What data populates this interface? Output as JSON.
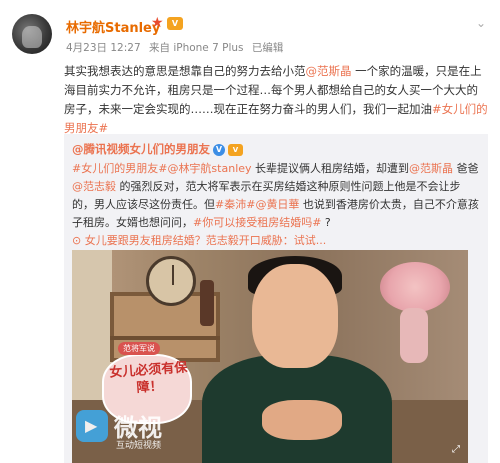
{
  "post": {
    "username": "林宇航Stanley",
    "date": "4月23日 12:27",
    "source": "来自 iPhone 7 Plus",
    "edited": "已编辑",
    "text_intro": "其实我想表达的意思是想靠自己的努力去给小范",
    "mention1": "@范斯晶",
    "text_mid": " 一个家的温暖，只是在上海目前实力不允许，租房只是一个过程…每个男人都想给自己的女人买一个大大的房子，未来一定会实现的……现在正在努力奋斗的男人们，我们一起加油",
    "hashtag": "#女儿们的男朋友#"
  },
  "repost": {
    "username": "@腾讯视频女儿们的男朋友",
    "text_hashtag": "#女儿们的男朋友#",
    "mention_author": "@林宇航stanley",
    "text_a": " 长辈提议俩人租房结婚，却遭到",
    "mention_fan": "@范斯晶",
    "text_b": " 爸爸",
    "mention_zhi": "@范志毅",
    "text_c": " 的强烈反对，范大将军表示在买房结婚这种原则性问题上他是不会让步的，男人应该尽这份责任。但",
    "mention_mao": "#秦沛#",
    "mention_huang": "@黄日華",
    "text_d": " 也说到香港房价太贵，自己不介意孩子租房。女婿也想问问，",
    "hashtag_question": "#你可以接受租房结婚吗#",
    "text_e": " ?",
    "link_label": "女儿要跟男友租房结婚？范志毅开口威胁：试试..."
  },
  "video": {
    "badge": "范将军说",
    "caption": "女儿必须有保障！",
    "watermark_name": "微视",
    "watermark_sub": "互动短视频"
  },
  "colors": {
    "accent": "#eb7350",
    "username": "#e86b00",
    "verified": "#3d8ee5"
  }
}
